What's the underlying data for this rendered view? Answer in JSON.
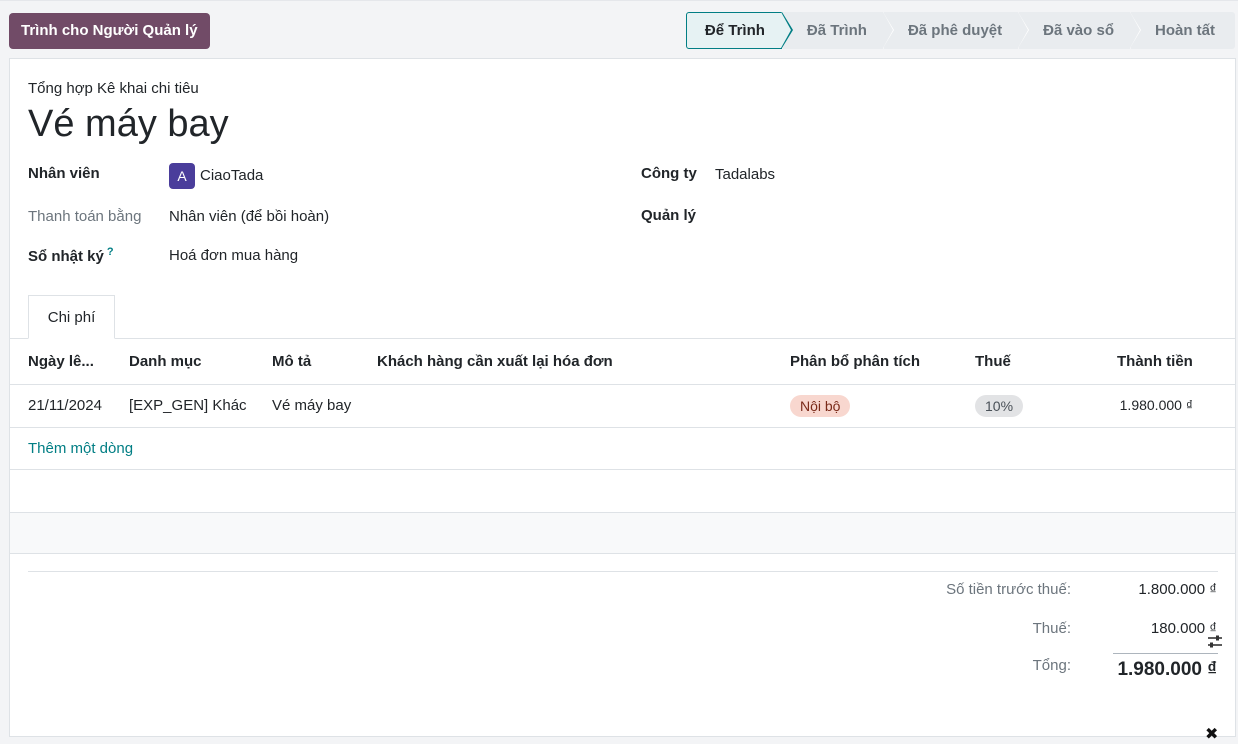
{
  "header": {
    "submit_button": "Trình cho Người Quản lý",
    "stages": [
      "Để Trình",
      "Đã Trình",
      "Đã phê duyệt",
      "Đã vào sổ",
      "Hoàn tất"
    ]
  },
  "form": {
    "subtitle": "Tổng hợp Kê khai chi tiêu",
    "title": "Vé máy bay",
    "employee_label": "Nhân viên",
    "employee_avatar": "A",
    "employee_value": "CiaoTada",
    "payment_label": "Thanh toán bằng",
    "payment_value": "Nhân viên (để bồi hoàn)",
    "journal_label": "Sổ nhật ký",
    "journal_help": "?",
    "journal_value": "Hoá đơn mua hàng",
    "company_label": "Công ty",
    "company_value": "Tadalabs",
    "manager_label": "Quản lý",
    "manager_value": ""
  },
  "tabs": {
    "expenses": "Chi phí"
  },
  "table": {
    "columns": [
      "Ngày lê...",
      "Danh mục",
      "Mô tả",
      "Khách hàng cần xuất lại hóa đơn",
      "Phân bổ phân tích",
      "Thuế",
      "Thành tiền"
    ],
    "rows": [
      {
        "date": "21/11/2024",
        "category": "[EXP_GEN] Khác",
        "description": "Vé máy bay",
        "customer": "",
        "analytic": "Nội bộ",
        "tax": "10%",
        "amount": "1.980.000 ₫"
      }
    ],
    "add_line": "Thêm một dòng"
  },
  "totals": {
    "untaxed_label": "Số tiền trước thuế:",
    "untaxed_value": "1.800.000 ₫",
    "tax_label": "Thuế:",
    "tax_value": "180.000 ₫",
    "total_label": "Tổng:",
    "total_value": "1.980.000 ₫"
  },
  "colors": {
    "primary": "#714b67",
    "accent": "#017e84"
  },
  "icons": [
    "settings-sliders-icon",
    "close-icon"
  ]
}
